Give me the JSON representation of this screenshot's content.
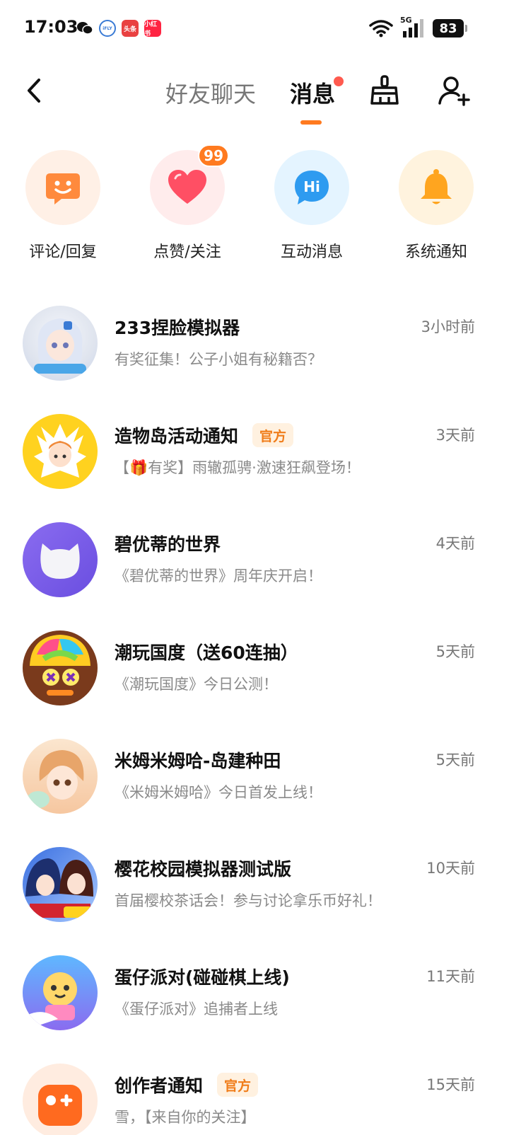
{
  "status_bar": {
    "time": "17:03",
    "apps": [
      "wechat-icon",
      "ifly-icon",
      "toutiao-icon",
      "xiaohongshu-icon"
    ],
    "toutiao_label": "头条",
    "xhs_label": "小红书",
    "network": "5G",
    "battery": "83"
  },
  "header": {
    "tabs": [
      {
        "label": "好友聊天",
        "active": false
      },
      {
        "label": "消息",
        "active": true
      }
    ],
    "accent": "#ff7a1f"
  },
  "quick_entries": [
    {
      "label": "评论/回复",
      "icon": "smile-bubble-icon"
    },
    {
      "label": "点赞/关注",
      "icon": "heart-icon",
      "badge": "99"
    },
    {
      "label": "互动消息",
      "icon": "hi-bubble-icon"
    },
    {
      "label": "系统通知",
      "icon": "bell-icon"
    }
  ],
  "messages": [
    {
      "title": "233捏脸模拟器",
      "tag": "",
      "time": "3小时前",
      "preview": "有奖征集！公子小姐有秘籍否？"
    },
    {
      "title": "造物岛活动通知",
      "tag": "官方",
      "time": "3天前",
      "preview": "【🎁有奖】雨辙孤骋·激速狂飙登场！"
    },
    {
      "title": "碧优蒂的世界",
      "tag": "",
      "time": "4天前",
      "preview": "《碧优蒂的世界》周年庆开启！"
    },
    {
      "title": "潮玩国度（送60连抽）",
      "tag": "",
      "time": "5天前",
      "preview": "《潮玩国度》今日公测！"
    },
    {
      "title": "米姆米姆哈-岛建种田",
      "tag": "",
      "time": "5天前",
      "preview": "《米姆米姆哈》今日首发上线！"
    },
    {
      "title": "樱花校园模拟器测试版",
      "tag": "",
      "time": "10天前",
      "preview": "首届樱校茶话会！参与讨论拿乐币好礼！"
    },
    {
      "title": "蛋仔派对(碰碰棋上线)",
      "tag": "",
      "time": "11天前",
      "preview": "《蛋仔派对》追捕者上线"
    },
    {
      "title": "创作者通知",
      "tag": "官方",
      "time": "15天前",
      "preview": "雪，【来自你的关注】"
    }
  ]
}
